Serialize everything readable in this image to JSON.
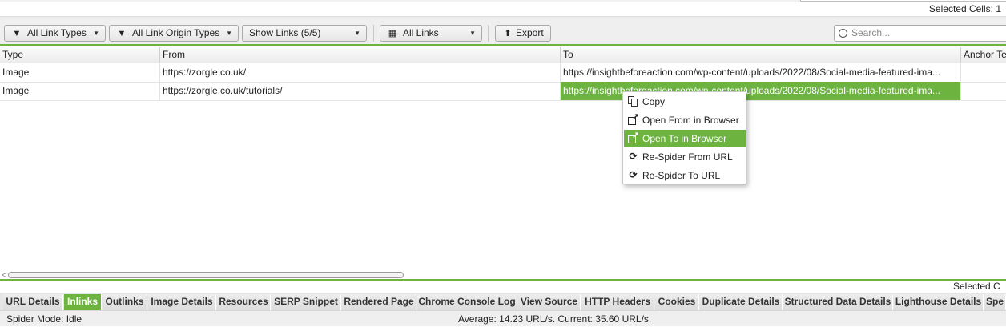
{
  "header": {
    "selected_cells_label": "Selected Cells:",
    "selected_cells_value": "1"
  },
  "toolbar": {
    "link_types": "All Link Types",
    "link_origin_types": "All Link Origin Types",
    "show_links": "Show Links (5/5)",
    "all_links": "All Links",
    "export": "Export",
    "search_placeholder": "Search..."
  },
  "table": {
    "columns": [
      "Type",
      "From",
      "To",
      "Anchor Te"
    ],
    "rows": [
      {
        "type": "Image",
        "from": "https://zorgle.co.uk/",
        "to": "https://insightbeforeaction.com/wp-content/uploads/2022/08/Social-media-featured-ima..."
      },
      {
        "type": "Image",
        "from": "https://zorgle.co.uk/tutorials/",
        "to": "https://insightbeforeaction.com/wp-content/uploads/2022/08/Social-media-featured-ima..."
      }
    ]
  },
  "context_menu": {
    "items": [
      {
        "label": "Copy",
        "icon": "copy-icon"
      },
      {
        "label": "Open From in Browser",
        "icon": "external-link-icon"
      },
      {
        "label": "Open To in Browser",
        "icon": "external-link-icon"
      },
      {
        "label": "Re-Spider From URL",
        "icon": "refresh-icon"
      },
      {
        "label": "Re-Spider To URL",
        "icon": "refresh-icon"
      }
    ],
    "highlighted_index": 2
  },
  "bottom": {
    "selected_label": "Selected C"
  },
  "tabs": [
    "URL Details",
    "Inlinks",
    "Outlinks",
    "Image Details",
    "Resources",
    "SERP Snippet",
    "Rendered Page",
    "Chrome Console Log",
    "View Source",
    "HTTP Headers",
    "Cookies",
    "Duplicate Details",
    "Structured Data Details",
    "Lighthouse Details",
    "Spe"
  ],
  "active_tab": "Inlinks",
  "status": {
    "mode": "Spider Mode: Idle",
    "speed": "Average: 14.23 URL/s. Current: 35.60 URL/s."
  },
  "colors": {
    "accent": "#6cb33f"
  }
}
